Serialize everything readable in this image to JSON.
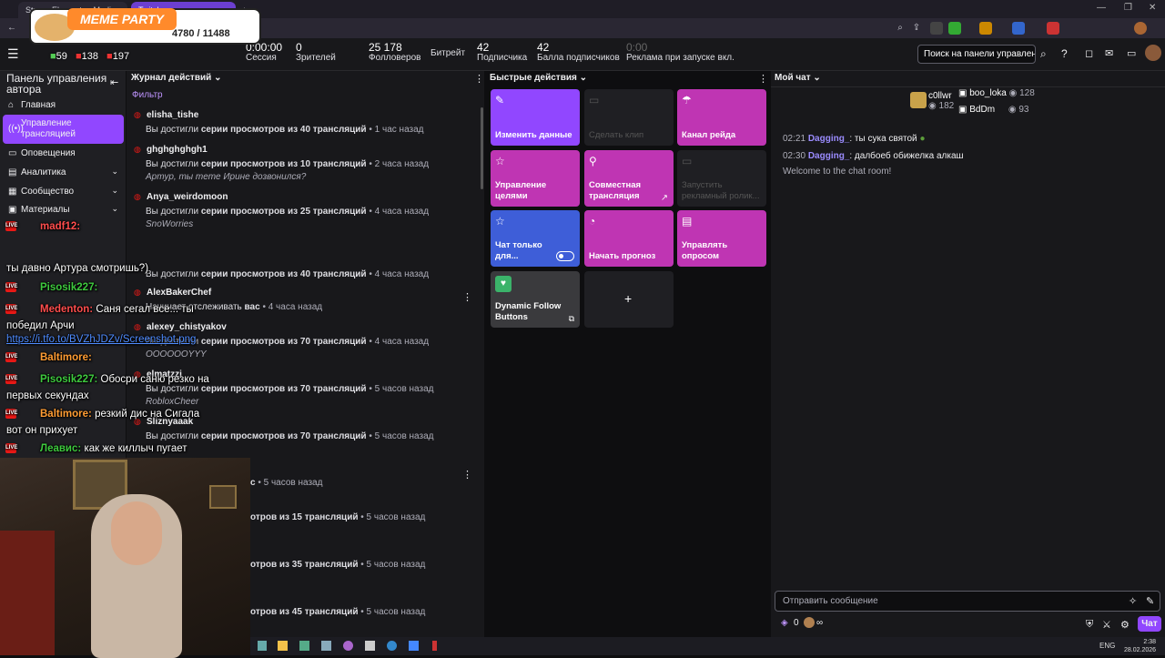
{
  "browser": {
    "tabs": [
      "StreamElements - Media re...",
      "Twitch"
    ],
    "new_tab": "+"
  },
  "overlay_banner": {
    "title": "MEME PARTY",
    "counter": "4780 / 11488"
  },
  "header": {
    "overlay_counts": [
      "59",
      "138",
      "197"
    ],
    "stats": [
      {
        "value": "0:00:00",
        "label": "Сессия"
      },
      {
        "value": "0",
        "label": "Зрителей"
      },
      {
        "value": "25 178",
        "label": "Фолловеров"
      },
      {
        "value": "",
        "label": "Битрейт"
      },
      {
        "value": "42",
        "label": "Подписчика"
      },
      {
        "value": "42",
        "label": "Балла подписчиков"
      },
      {
        "value": "0:00",
        "label": "Реклама при запуске вкл."
      }
    ],
    "search_placeholder": "Поиск на панели управлени"
  },
  "sidebar": {
    "title": "Панель управления автора",
    "items": [
      {
        "label": "Главная",
        "icon": "home-icon"
      },
      {
        "label": "Управление трансляцией",
        "icon": "broadcast-icon",
        "active": true
      },
      {
        "label": "Оповещения",
        "icon": "bell-icon"
      },
      {
        "label": "Аналитика",
        "icon": "chart-icon",
        "expand": true
      },
      {
        "label": "Сообщество",
        "icon": "people-icon",
        "expand": true
      },
      {
        "label": "Материалы",
        "icon": "film-icon",
        "expand": true
      }
    ]
  },
  "activity": {
    "title": "Журнал действий",
    "filter": "Фильтр",
    "entries": [
      {
        "user": "elisha_tishe",
        "pre": "Вы достигли ",
        "bold": "серии просмотров из 40 трансляций",
        "time": "• 1 час назад",
        "msg": ""
      },
      {
        "user": "ghghghghgh1",
        "pre": "Вы достигли ",
        "bold": "серии просмотров из 10 трансляций",
        "time": "• 2 часа назад",
        "msg": "Артур, ты тете Ирине дозвонился?"
      },
      {
        "user": "Anya_weirdomoon",
        "pre": "Вы достигли ",
        "bold": "серии просмотров из 25 трансляций",
        "time": "• 4 часа назад",
        "msg": "SnoWorries"
      },
      {
        "user": "",
        "pre": "Вы достигли ",
        "bold": "серии просмотров из 40 трансляций",
        "time": "• 4 часа назад",
        "msg": ""
      },
      {
        "user": "AlexBakerChef",
        "pre": "Начинает отслеживать ",
        "bold": "вас",
        "time": "• 4 часа назад",
        "msg": ""
      },
      {
        "user": "alexey_chistyakov",
        "pre": "Вы достигли ",
        "bold": "серии просмотров из 70 трансляций",
        "time": "• 4 часа назад",
        "msg": "OOOOOOYYY"
      },
      {
        "user": "elmatzzi",
        "pre": "Вы достигли ",
        "bold": "серии просмотров из 70 трансляций",
        "time": "• 5 часов назад",
        "msg": "RobloxCheer"
      },
      {
        "user": "Sliznyaaak",
        "pre": "Вы достигли ",
        "bold": "серии просмотров из 70 трансляций",
        "time": "• 5 часов назад",
        "msg": ""
      },
      {
        "user": "",
        "pre": "",
        "bold": "с",
        "time": "• 5 часов назад",
        "msg": ""
      },
      {
        "user": "",
        "pre": "",
        "bold": "отров из 15 трансляций",
        "time": "• 5 часов назад",
        "msg": ""
      },
      {
        "user": "",
        "pre": "",
        "bold": "отров из 35 трансляций",
        "time": "• 5 часов назад",
        "msg": ""
      },
      {
        "user": "",
        "pre": "",
        "bold": "отров из 45 трансляций",
        "time": "• 5 часов назад",
        "msg": ""
      }
    ]
  },
  "quick_actions": {
    "title": "Быстрые действия",
    "tiles": [
      {
        "label": "Изменить данные",
        "color": "#9147ff",
        "icon": "pencil-icon"
      },
      {
        "label": "Сделать клип",
        "color": "#1f1f23",
        "icon": "clip-icon",
        "disabled": true
      },
      {
        "label": "Канал рейда",
        "color": "#bf35b3",
        "icon": "parachute-icon"
      },
      {
        "label": "Управление целями",
        "color": "#bf35b3",
        "icon": "star-icon"
      },
      {
        "label": "Совместная трансляция",
        "color": "#bf35b3",
        "icon": "add-person-icon"
      },
      {
        "label": "Запустить рекламный ролик...",
        "color": "#1f1f23",
        "icon": "ad-icon",
        "disabled": true
      },
      {
        "label": "Чат только для...",
        "color": "#3e5ed8",
        "icon": "star-icon"
      },
      {
        "label": "Начать прогноз",
        "color": "#bf35b3",
        "icon": "predict-icon"
      },
      {
        "label": "Управлять опросом",
        "color": "#bf35b3",
        "icon": "poll-icon"
      },
      {
        "label": "Dynamic Follow Buttons",
        "color": "#3a3a3d",
        "icon": "extension-icon"
      },
      {
        "label": "+",
        "color": "#1f1f23",
        "icon": "add-icon"
      }
    ]
  },
  "chat": {
    "title": "Мой чат",
    "top_users": [
      {
        "name": "c0llwr",
        "count": "182"
      },
      {
        "name": "boo_loka",
        "count": "128"
      },
      {
        "name": "BdDm",
        "count": "93"
      }
    ],
    "messages": [
      {
        "time": "02:21",
        "user": "Dagging_",
        "text": ": ты сука святой"
      },
      {
        "time": "02:30",
        "user": "Dagging_",
        "text": ": далбоеб обижелка алкаш"
      }
    ],
    "welcome": "Welcome to the chat room!",
    "input_placeholder": "Отправить сообщение",
    "points": "0",
    "infinity": "∞",
    "send_label": "Чат"
  },
  "overlay_chat": [
    {
      "user": "madf12:",
      "user_color": "#ff4d4d",
      "text": ""
    },
    {
      "user": "",
      "user_color": "#fff",
      "text": "ты давно Артура смотришь?)"
    },
    {
      "user": "Pisosik227:",
      "user_color": "#3ec93e",
      "text": ""
    },
    {
      "user": "Medenton:",
      "user_color": "#ff4d4d",
      "text": "Саня сегал все... ты"
    },
    {
      "user": "",
      "user_color": "#fff",
      "text": "победил Арчи"
    },
    {
      "user": "",
      "user_color": "#4f8cff",
      "text": "https://i.tfo.to/BVZhJDZv/Screenshot.png"
    },
    {
      "user": "Baltimore:",
      "user_color": "#ff9c33",
      "text": ""
    },
    {
      "user": "Pisosik227:",
      "user_color": "#3ec93e",
      "text": "Обосри саню резко на"
    },
    {
      "user": "",
      "user_color": "#fff",
      "text": "первых секундах"
    },
    {
      "user": "Baltimore:",
      "user_color": "#ff9c33",
      "text": "резкий дис на Сигала"
    },
    {
      "user": "",
      "user_color": "#fff",
      "text": "вот он прихует"
    },
    {
      "user": "Леавис:",
      "user_color": "#3ec93e",
      "text": "как же киллыч пугает"
    }
  ],
  "taskbar": {
    "lang": "ENG",
    "time": "2:38",
    "date": "28.02.2026"
  }
}
